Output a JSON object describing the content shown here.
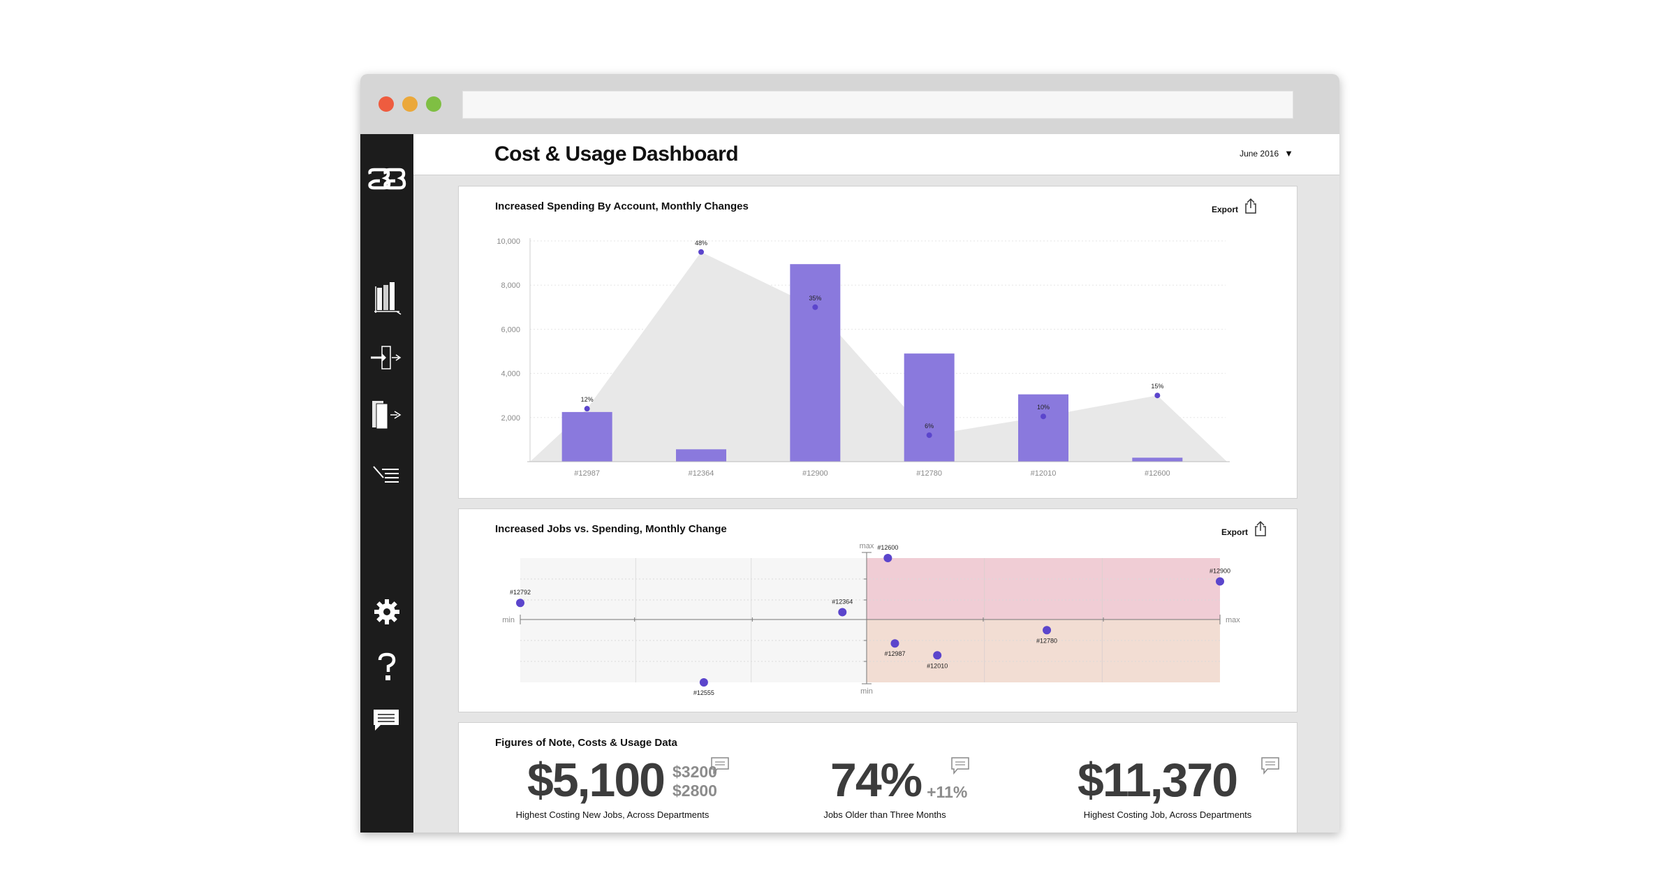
{
  "window": {
    "url": ""
  },
  "sidebar": {
    "items": [
      {
        "icon": "logo-icon"
      },
      {
        "icon": "bar-chart-icon"
      },
      {
        "icon": "import-icon"
      },
      {
        "icon": "documents-export-icon"
      },
      {
        "icon": "list-icon"
      },
      {
        "icon": "gear-icon"
      },
      {
        "icon": "help-icon"
      },
      {
        "icon": "chat-icon"
      }
    ]
  },
  "header": {
    "title": "Cost & Usage Dashboard",
    "date": "June 2016",
    "date_caret": "▼"
  },
  "card1": {
    "title": "Increased Spending By Account, Monthly Changes",
    "export_label": "Export"
  },
  "card2": {
    "title": "Increased Jobs vs. Spending, Monthly Change",
    "export_label": "Export"
  },
  "card3": {
    "title": "Figures of Note, Costs & Usage Data",
    "figures": [
      {
        "value": "$5,100",
        "side": [
          "$3200",
          "$2800"
        ],
        "caption": "Highest Costing New Jobs, Across Departments"
      },
      {
        "value": "74%",
        "side": [
          "+11%"
        ],
        "caption": "Jobs Older than Three Months"
      },
      {
        "value": "$11,370",
        "side": [],
        "caption": "Highest Costing Job, Across Departments"
      }
    ]
  },
  "chart_data": [
    {
      "type": "bar",
      "title": "Increased Spending By Account, Monthly Changes",
      "categories": [
        "#12987",
        "#12364",
        "#12900",
        "#12780",
        "#12010",
        "#12600"
      ],
      "ylim": [
        0,
        10000
      ],
      "yticks": [
        "2,000",
        "4,000",
        "6,000",
        "8,000",
        "10,000"
      ],
      "ytick_values": [
        2000,
        4000,
        6000,
        8000,
        10000
      ],
      "series": [
        {
          "values": [
            2250,
            560,
            8950,
            4900,
            3050,
            180
          ]
        }
      ],
      "overlay": {
        "type": "area",
        "labels": [
          "12%",
          "48%",
          "35%",
          "6%",
          "10%",
          "15%"
        ],
        "values": [
          2400,
          9500,
          7000,
          1200,
          2050,
          3000
        ]
      },
      "bar_color": "#8a79dd",
      "point_color": "#5b45cc",
      "grid": true
    },
    {
      "type": "scatter",
      "title": "Increased Jobs vs. Spending, Monthly Change",
      "axis_labels": {
        "xmin": "min",
        "xmax": "max",
        "ymin": "min",
        "ymax": "max"
      },
      "xlim": [
        -1,
        1
      ],
      "ylim": [
        -1,
        1
      ],
      "points": [
        {
          "label": "#12792",
          "x": -1.0,
          "y": 0.27
        },
        {
          "label": "#12364",
          "x": -0.07,
          "y": 0.12
        },
        {
          "label": "#12555",
          "x": -0.47,
          "y": -1.0
        },
        {
          "label": "#12600",
          "x": 0.06,
          "y": 1.0
        },
        {
          "label": "#12900",
          "x": 1.0,
          "y": 0.62
        },
        {
          "label": "#12987",
          "x": 0.08,
          "y": -0.38
        },
        {
          "label": "#12010",
          "x": 0.2,
          "y": -0.57
        },
        {
          "label": "#12780",
          "x": 0.51,
          "y": -0.17
        }
      ],
      "quadrant_colors": {
        "top_right": "#f0cdd5",
        "bottom_right": "#f2ddd3",
        "left": "#f6f6f6"
      },
      "point_color": "#5b45cc",
      "grid": true
    }
  ]
}
